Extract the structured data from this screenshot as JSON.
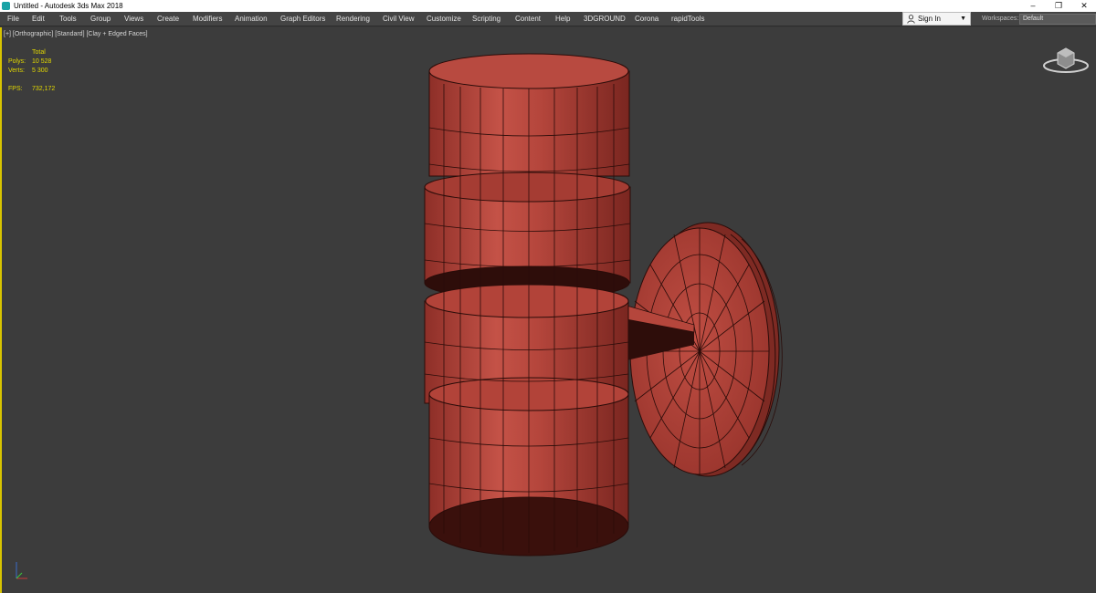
{
  "window": {
    "title": "Untitled - Autodesk 3ds Max 2018",
    "controls": [
      "–",
      "❐",
      "✕"
    ]
  },
  "menu": [
    "File",
    "Edit",
    "Tools",
    "Group",
    "Views",
    "Create",
    "Modifiers",
    "Animation",
    "Graph Editors",
    "Rendering",
    "Civil View",
    "Customize",
    "Scripting",
    "Content",
    "Help",
    "3DGROUND",
    "Corona",
    "rapidTools"
  ],
  "signin": {
    "label": "Sign In",
    "icon": "user-icon"
  },
  "workspaces": {
    "label": "Workspaces:",
    "value": "Default"
  },
  "viewport": {
    "label": "[+] [Orthographic] [Standard] [Clay + Edged Faces]",
    "stats": {
      "total_label": "Total",
      "polys_label": "Polys:",
      "polys_value": "10 528",
      "verts_label": "Verts:",
      "verts_value": "5 300",
      "fps_label": "FPS:",
      "fps_value": "732,172"
    }
  },
  "colors": {
    "clay": "#b2433a",
    "clay_dark": "#4a1612",
    "background": "#3c3c3c",
    "active_border": "#d8c400",
    "stats_text": "#e2d800"
  }
}
